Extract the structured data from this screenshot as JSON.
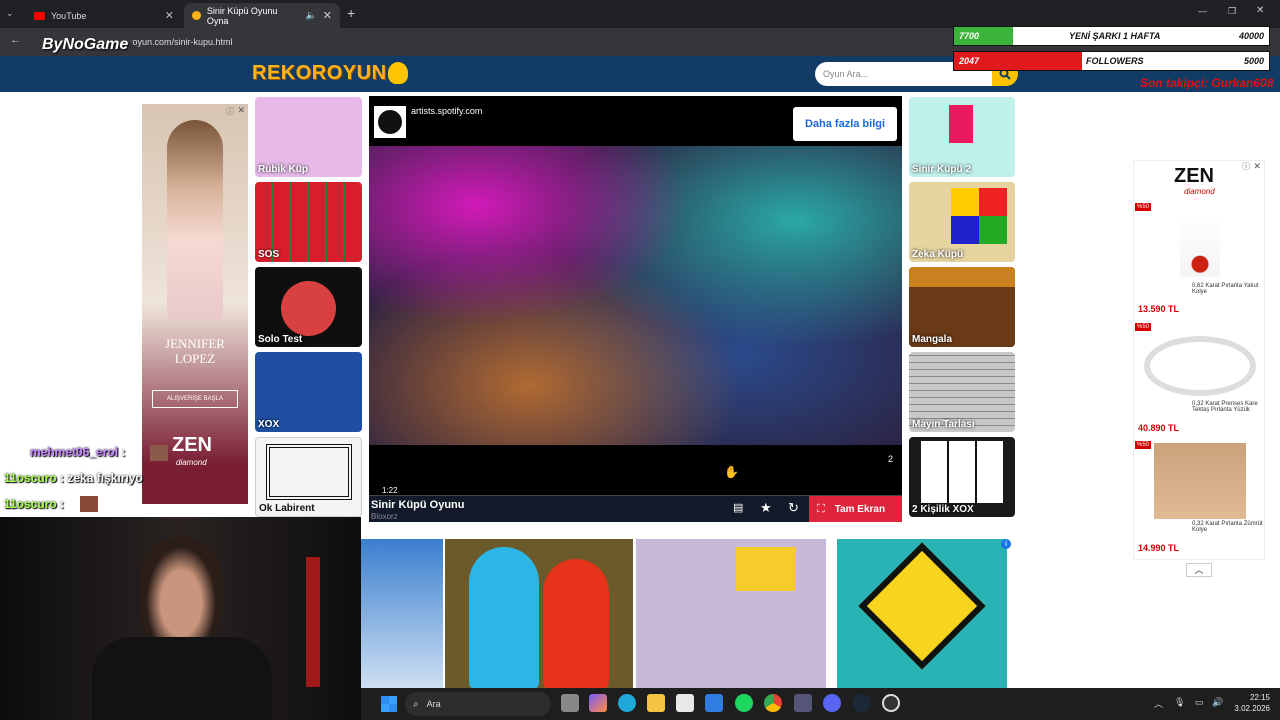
{
  "browser": {
    "tabs": [
      {
        "label": "YouTube",
        "close": "✕"
      },
      {
        "label": "Sinir Küpü Oyunu Oyna",
        "close": "✕"
      }
    ],
    "new_tab": "+",
    "url": "rekoroyun.com/sinir-kupu.html",
    "window_buttons": [
      "—",
      "❐",
      "✕"
    ]
  },
  "site": {
    "logo": "REKOROYUN",
    "search_placeholder": "Oyun Ara...",
    "left_tiles": [
      {
        "label": "Rubik Küp",
        "color": "#e6b9e9"
      },
      {
        "label": "SOS",
        "color": "#2c7d3a"
      },
      {
        "label": "Solo Test",
        "color": "#0f0f0f"
      },
      {
        "label": "XOX",
        "color": "#1e4fa0"
      },
      {
        "label": "Ok Labirent",
        "color": "#f4f4f4"
      }
    ],
    "right_tiles": [
      {
        "label": "Sinir Küpü 2",
        "color": "#bff0ea"
      },
      {
        "label": "Zeka Küpü",
        "color": "#e5d4a0"
      },
      {
        "label": "Mangala",
        "color": "#6a3a17"
      },
      {
        "label": "Mayın Tarlası",
        "color": "#c8c8c8"
      },
      {
        "label": "2 Kişilik XOX",
        "color": "#1a1a1a"
      }
    ],
    "player": {
      "ad_source": "artists.spotify.com",
      "ad_button": "Daha fazla bilgi",
      "time": "1:22",
      "counter": "2",
      "game_title": "Sinir Küpü Oyunu",
      "game_author": "Bloxorz",
      "fullscreen": "Tam Ekran"
    },
    "bottom_thumbs": [
      "#3b7fcf",
      "#6b5a2a",
      "#c8b9d8",
      "#29b3b5"
    ]
  },
  "ads": {
    "left": {
      "brand": "JENNIFER LOPEZ",
      "cta": "ALIŞVERİŞE BAŞLA",
      "sponsor": "ZEN",
      "sponsor_sub": "diamond"
    },
    "right": {
      "brand": "ZEN",
      "brand_sub": "diamond",
      "items": [
        {
          "badge": "%50",
          "name": "0,62 Karat Pırlanta Yakut Kolye",
          "price": "13.590 TL"
        },
        {
          "badge": "%50",
          "name": "0,32 Karat Prenses Kare Tektaş Pırlanta Yüzük",
          "price": "40.890 TL"
        },
        {
          "badge": "%50",
          "name": "0,32 Karat Pırlanta Zümrüt Kolye",
          "price": "14.990 TL"
        }
      ]
    }
  },
  "overlay": {
    "channel": "ByNoGame",
    "bars": [
      {
        "value": "7700",
        "label": "YENİ ŞARKI 1 HAFTA",
        "goal": "40000",
        "fill": 0.19,
        "color": "#3cb43c"
      },
      {
        "value": "2047",
        "label": "FOLLOWERS",
        "goal": "5000",
        "fill": 0.41,
        "color": "#e0191c"
      }
    ],
    "last_follow": "Son takipçi: Gurkan608",
    "chat": [
      {
        "user": "mehmet06_erol",
        "msg": ":"
      },
      {
        "user": "11oscuro",
        "msg": ": zeka fışkırıyo"
      },
      {
        "user": "11oscuro",
        "msg": ":"
      }
    ]
  },
  "taskbar": {
    "search": "Ara",
    "time": "22:15",
    "date": "3.02.2026"
  }
}
